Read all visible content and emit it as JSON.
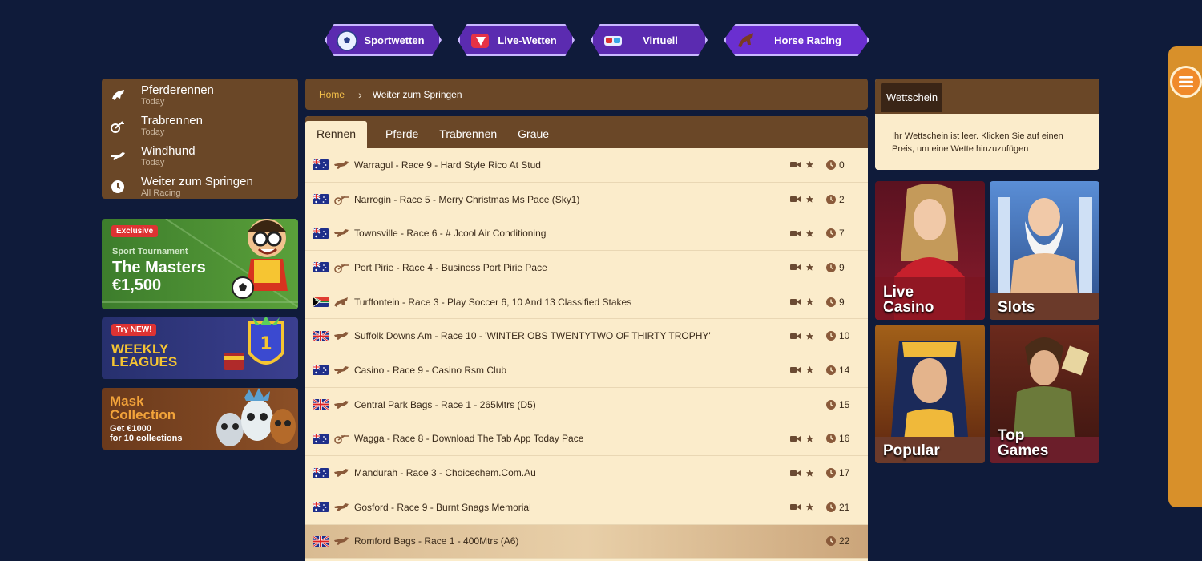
{
  "topnav": [
    {
      "label": "Sportwetten",
      "icon": "soccer-ball-icon"
    },
    {
      "label": "Live-Wetten",
      "icon": "live-play-icon"
    },
    {
      "label": "Virtuell",
      "icon": "vr-goggles-icon"
    },
    {
      "label": "Horse Racing",
      "icon": "horse-icon"
    }
  ],
  "sidebar": {
    "items": [
      {
        "title": "Pferderennen",
        "sub": "Today",
        "icon": "horse-head-icon"
      },
      {
        "title": "Trabrennen",
        "sub": "Today",
        "icon": "harness-racing-icon"
      },
      {
        "title": "Windhund",
        "sub": "Today",
        "icon": "greyhound-icon"
      },
      {
        "title": "Weiter zum Springen",
        "sub": "All Racing",
        "icon": "clock-icon"
      }
    ]
  },
  "promos": {
    "masters": {
      "badge": "Exclusive",
      "small": "Sport Tournament",
      "line1": "The Masters",
      "line2": "€1,500"
    },
    "weekly": {
      "badge": "Try NEW!",
      "line1": "WEEKLY",
      "line2": "LEAGUES"
    },
    "mask": {
      "line1": "Mask",
      "line2": "Collection",
      "line3": "Get €1000",
      "line4": "for 10 collections"
    }
  },
  "breadcrumb": {
    "home": "Home",
    "separator": "›",
    "current": "Weiter zum Springen"
  },
  "tabs": [
    "Rennen",
    "Pferde",
    "Trabrennen",
    "Graue"
  ],
  "races": [
    {
      "flag": "AU",
      "type": "greyhound",
      "name": "Warragul - Race 9 - Hard Style Rico At Stud",
      "video": true,
      "mins": "0"
    },
    {
      "flag": "AU",
      "type": "harness",
      "name": "Narrogin - Race 5 - Merry Christmas Ms Pace (Sky1)",
      "video": true,
      "mins": "2"
    },
    {
      "flag": "AU",
      "type": "greyhound",
      "name": "Townsville - Race 6 - # Jcool Air Conditioning",
      "video": true,
      "mins": "7"
    },
    {
      "flag": "AU",
      "type": "harness",
      "name": "Port Pirie - Race 4 - Business Port Pirie Pace",
      "video": true,
      "mins": "9"
    },
    {
      "flag": "ZA",
      "type": "horse",
      "name": "Turffontein - Race 3 - Play Soccer 6, 10 And 13 Classified Stakes",
      "video": true,
      "mins": "9"
    },
    {
      "flag": "GB",
      "type": "greyhound",
      "name": "Suffolk Downs Am - Race 10 - 'WINTER OBS TWENTYTWO OF THIRTY TROPHY'",
      "video": true,
      "mins": "10"
    },
    {
      "flag": "AU",
      "type": "greyhound",
      "name": "Casino - Race 9 - Casino Rsm Club",
      "video": true,
      "mins": "14"
    },
    {
      "flag": "GB",
      "type": "greyhound",
      "name": "Central Park Bags - Race 1 - 265Mtrs (D5)",
      "video": false,
      "mins": "15"
    },
    {
      "flag": "AU",
      "type": "harness",
      "name": "Wagga - Race 8 - Download The Tab App Today Pace",
      "video": true,
      "mins": "16"
    },
    {
      "flag": "AU",
      "type": "greyhound",
      "name": "Mandurah - Race 3 - Choicechem.Com.Au",
      "video": true,
      "mins": "17"
    },
    {
      "flag": "AU",
      "type": "greyhound",
      "name": "Gosford - Race 9 - Burnt Snags Memorial",
      "video": true,
      "mins": "21"
    },
    {
      "flag": "GB",
      "type": "greyhound",
      "name": "Romford Bags - Race 1 - 400Mtrs (A6)",
      "video": false,
      "mins": "22"
    }
  ],
  "betslip": {
    "title": "Wettschein",
    "message": "Ihr Wettschein ist leer. Klicken Sie auf einen Preis, um eine Wette hinzuzufügen"
  },
  "tiles": {
    "live": {
      "line1": "Live",
      "line2": "Casino"
    },
    "slots": {
      "line1": "Slots"
    },
    "popular": {
      "line1": "Popular"
    },
    "top": {
      "line1": "Top",
      "line2": "Games"
    }
  },
  "colors": {
    "brown": "#6a4727",
    "cream": "#fbeccb",
    "navy": "#0f1b3a",
    "purple": "#5b2bb0",
    "gold": "#f5c14a"
  }
}
